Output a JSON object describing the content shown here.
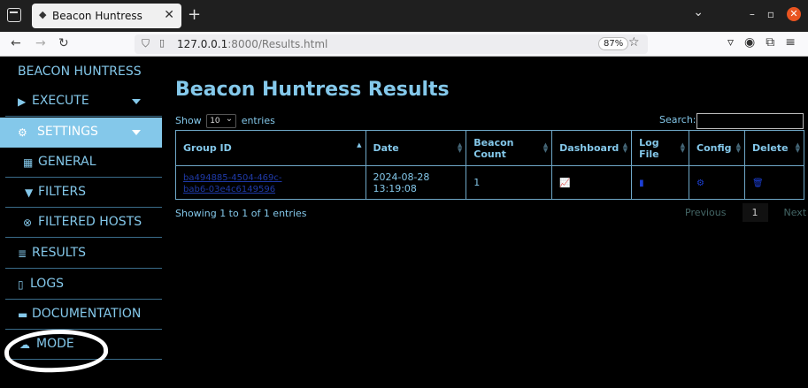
{
  "browser": {
    "tab_title": "Beacon Huntress",
    "url_host": "127.0.0.1",
    "url_rest": ":8000/Results.html",
    "zoom": "87%"
  },
  "sidebar": {
    "brand": "BEACON HUNTRESS",
    "items": [
      {
        "label": "EXECUTE",
        "icon": "play-icon"
      },
      {
        "label": "SETTINGS",
        "icon": "gears-icon"
      },
      {
        "label": "GENERAL",
        "icon": "toolbox-icon"
      },
      {
        "label": "FILTERS",
        "icon": "filter-icon"
      },
      {
        "label": "FILTERED HOSTS",
        "icon": "times-circle-icon"
      },
      {
        "label": "RESULTS",
        "icon": "database-icon"
      },
      {
        "label": "LOGS",
        "icon": "file-icon"
      },
      {
        "label": "DOCUMENTATION",
        "icon": "book-icon"
      },
      {
        "label": "MODE",
        "icon": "cloud-sun-icon"
      }
    ]
  },
  "main": {
    "title": "Beacon Huntress Results",
    "show_label": "Show",
    "entries_label": "entries",
    "page_size": "10",
    "search_label": "Search:",
    "search_value": "",
    "columns": [
      "Group ID",
      "Date",
      "Beacon Count",
      "Dashboard",
      "Log File",
      "Config",
      "Delete"
    ],
    "rows": [
      {
        "group_id_line1": "ba494885-4504-469c-",
        "group_id_line2": "bab6-03e4c6149596",
        "date_line1": "2024-08-28",
        "date_line2": "13:19:08",
        "beacon_count": "1"
      }
    ],
    "info": "Showing 1 to 1 of 1 entries",
    "pagination": {
      "previous": "Previous",
      "current": "1",
      "next": "Next"
    }
  }
}
